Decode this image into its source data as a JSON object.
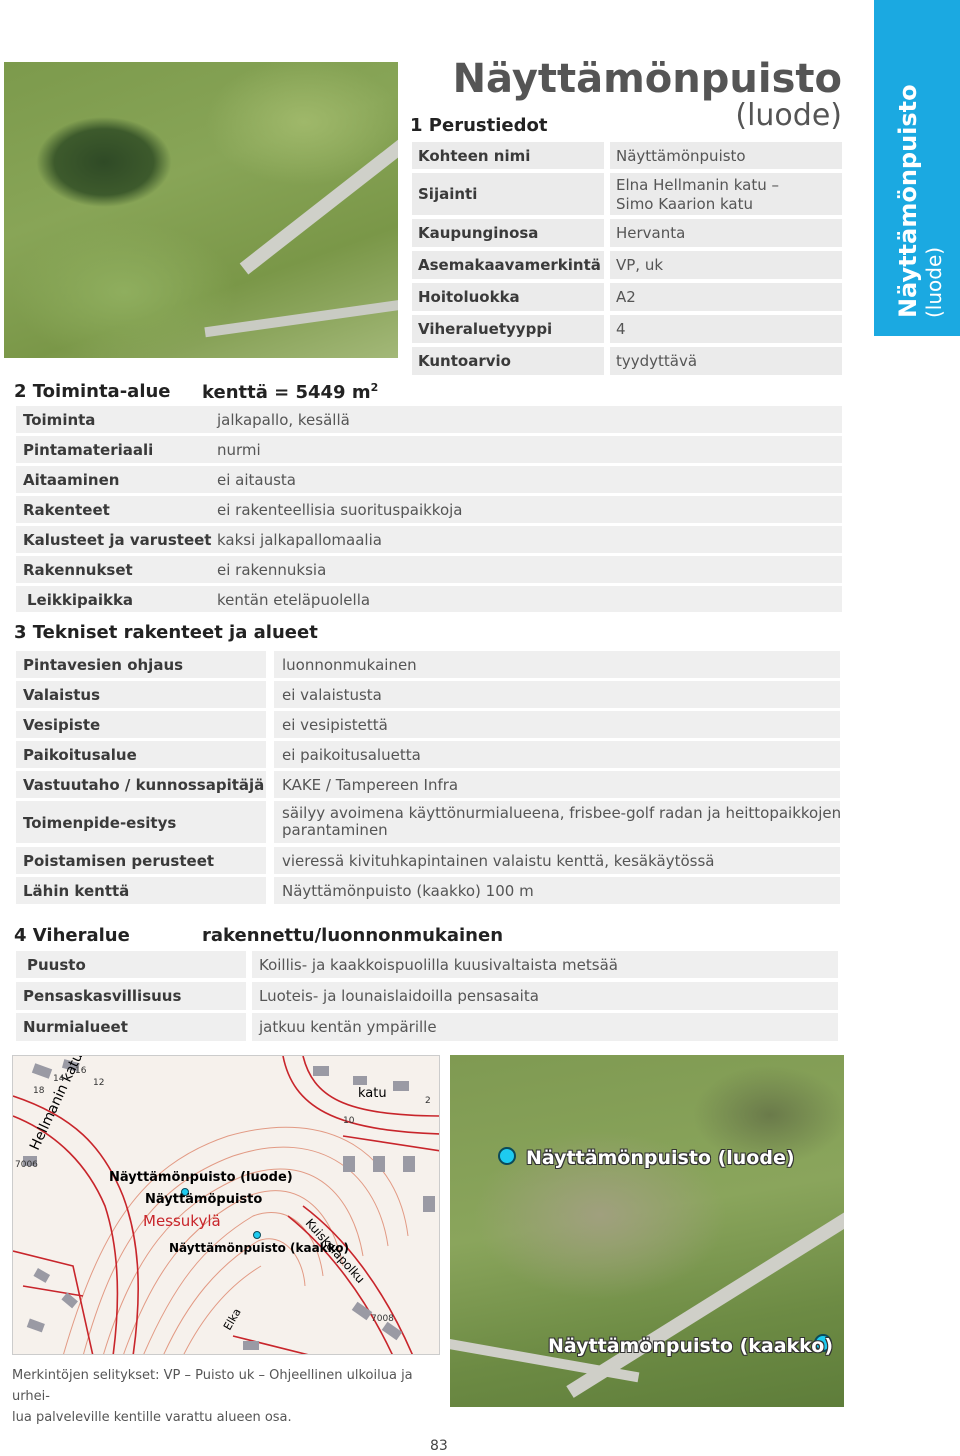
{
  "title": {
    "main": "Näyttämönpuisto",
    "sub": "(luode)"
  },
  "side_tab": {
    "line1": "Näyttämönpuisto",
    "line2": "(luode)"
  },
  "section1": {
    "heading": "1 Perustiedot",
    "rows": [
      {
        "label": "Kohteen nimi",
        "value": "Näyttämönpuisto"
      },
      {
        "label": "Sijainti",
        "value": "Elna Hellmanin katu –",
        "value2": "Simo Kaarion katu"
      },
      {
        "label": "Kaupunginosa",
        "value": "Hervanta"
      },
      {
        "label": "Asemakaavamerkintä",
        "value": "VP, uk"
      },
      {
        "label": "Hoitoluokka",
        "value": "A2"
      },
      {
        "label": "Viheraluetyyppi",
        "value": "4"
      },
      {
        "label": "Kuntoarvio",
        "value": "tyydyttävä"
      }
    ]
  },
  "section2": {
    "heading": "2 Toiminta-alue",
    "heading_value": "kenttä = 5449 m",
    "heading_sup": "2",
    "rows": [
      {
        "label": "Toiminta",
        "value": "jalkapallo, kesällä"
      },
      {
        "label": "Pintamateriaali",
        "value": "nurmi"
      },
      {
        "label": "Aitaaminen",
        "value": "ei aitausta"
      },
      {
        "label": "Rakenteet",
        "value": "ei rakenteellisia suorituspaikkoja"
      },
      {
        "label": "Kalusteet ja varusteet",
        "value": "kaksi jalkapallomaalia"
      },
      {
        "label": "Rakennukset",
        "value": "ei rakennuksia"
      },
      {
        "label": "Leikkipaikka",
        "value": "kentän eteläpuolella"
      }
    ]
  },
  "section3": {
    "heading": "3 Tekniset rakenteet ja alueet",
    "rows": [
      {
        "label": "Pintavesien ohjaus",
        "value": "luonnonmukainen"
      },
      {
        "label": "Valaistus",
        "value": "ei valaistusta"
      },
      {
        "label": "Vesipiste",
        "value": "ei vesipistettä"
      },
      {
        "label": "Paikoitusalue",
        "value": "ei paikoitusaluetta"
      },
      {
        "label": "Vastuutaho / kunnossapitäjä",
        "value": "KAKE / Tampereen Infra"
      },
      {
        "label": "Toimenpide-esitys",
        "value": "säilyy avoimena käyttönurmialueena, frisbee-golf radan ja heittopaikkojen",
        "value2": "parantaminen"
      },
      {
        "label": "Poistamisen perusteet",
        "value": "vieressä kivituhkapintainen valaistu kenttä, kesäkäytössä"
      },
      {
        "label": "Lähin kenttä",
        "value": "Näyttämönpuisto (kaakko) 100 m"
      }
    ]
  },
  "section4": {
    "heading": "4 Viheralue",
    "heading_value": "rakennettu/luonnonmukainen",
    "rows": [
      {
        "label": "Puusto",
        "value": "Koillis- ja kaakkoispuolilla kuusivaltaista metsää"
      },
      {
        "label": "Pensaskasvillisuus",
        "value": "Luoteis- ja lounaislaidoilla pensasaita"
      },
      {
        "label": "Nurmialueet",
        "value": "jatkuu kentän ympärille"
      }
    ]
  },
  "map": {
    "labels": [
      "Näyttämönpuisto (luode)",
      "Näyttämöpuisto",
      "Messukylä",
      "Näyttämönpuisto (kaakko)",
      "Hellmanin katu",
      "katu",
      "Kuiskeiapolku",
      "14",
      "16",
      "12",
      "18",
      "2",
      "10",
      "7006",
      "7008",
      "Elka"
    ],
    "colors": {
      "streets": "#c8252b",
      "buildings": "#9a9aa4",
      "contours": "#e29a84"
    }
  },
  "aerial": {
    "labels": [
      "Näyttämönpuisto (luode)",
      "Näyttämönpuisto (kaakko)"
    ],
    "dot_color": "#1ecbf0"
  },
  "legend_note": {
    "line1": "Merkintöjen selitykset: VP – Puisto uk – Ohjeellinen ulkoilua ja urhei-",
    "line2": "lua palveleville kentille varattu alueen osa."
  },
  "page_number": "83",
  "colors": {
    "accent": "#1ba9e1",
    "row_bg": "#ebebeb"
  }
}
